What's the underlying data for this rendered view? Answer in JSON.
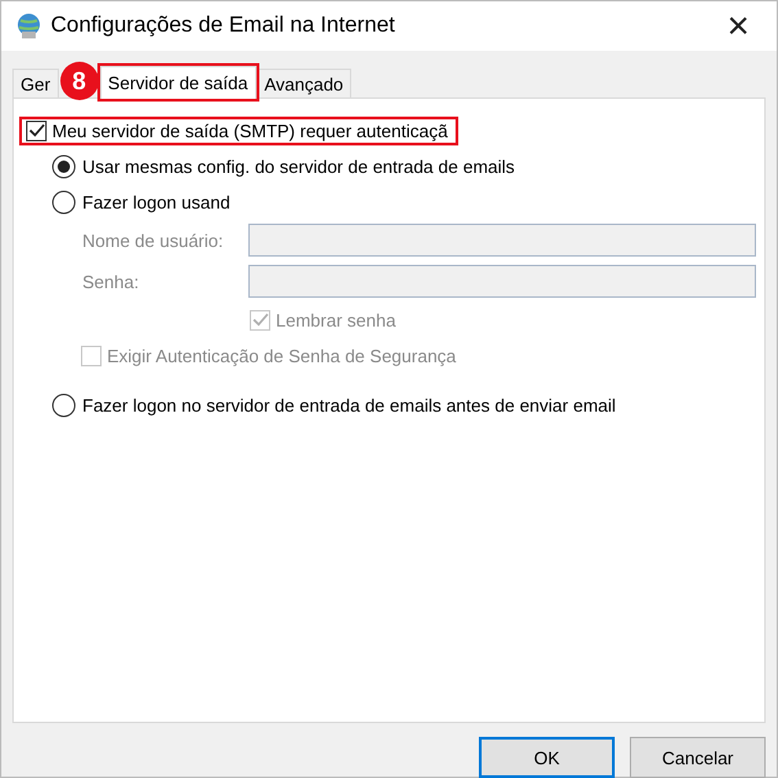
{
  "window": {
    "title": "Configurações de Email na Internet",
    "close": "×"
  },
  "tabs": [
    {
      "label": "Ger",
      "selected": false,
      "highlighted": false
    },
    {
      "label": "Servidor de saída",
      "selected": true,
      "highlighted": true
    },
    {
      "label": "Avançado",
      "selected": false,
      "highlighted": false
    }
  ],
  "step_badge": "8",
  "auth_checkbox": {
    "label": "Meu servidor de saída (SMTP) requer autenticaçã",
    "checked": true,
    "highlighted": true
  },
  "logon_options": [
    {
      "label": "Usar mesmas config. do servidor de entrada de emails",
      "selected": true
    },
    {
      "label": "Fazer logon usand",
      "selected": false
    }
  ],
  "fields": [
    {
      "label": "Nome de usuário:",
      "disabled": true
    },
    {
      "label": "Senha:",
      "disabled": true
    }
  ],
  "remember_password": {
    "label": "Lembrar senha",
    "checked": true,
    "disabled": true
  },
  "spa_checkbox": {
    "label": "Exigir Autenticação de Senha de Segurança",
    "checked": false,
    "disabled": true
  },
  "logon_before_send": {
    "label": "Fazer logon no servidor de entrada de emails antes de enviar email",
    "selected": false
  },
  "buttons": [
    {
      "label": "OK",
      "default": true
    },
    {
      "label": "Cancelar",
      "default": false
    }
  ]
}
